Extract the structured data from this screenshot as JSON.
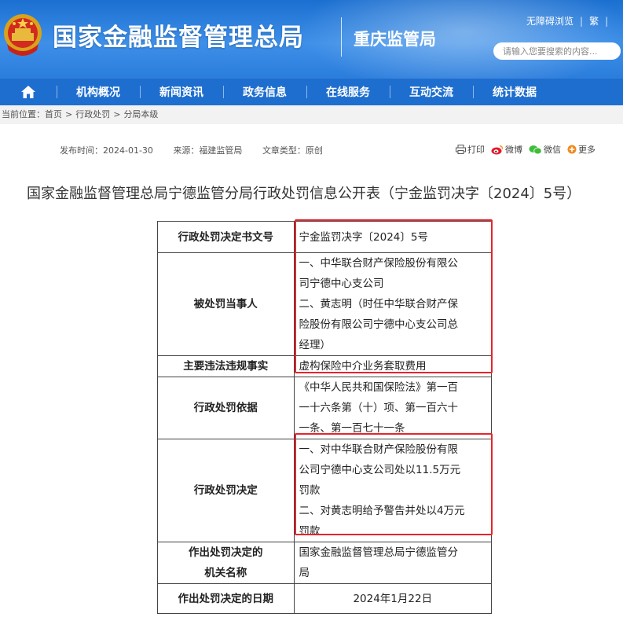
{
  "header": {
    "site_title": "国家金融监督管理总局",
    "bureau_name": "重庆监管局",
    "top_links": [
      "无障碍浏览",
      "繁"
    ],
    "search_placeholder": "请输入您要搜索的内容...",
    "colors": {
      "header_blue": "#2b7ddc",
      "nav_blue": "#1e6ecf",
      "highlight_red": "#e8232b"
    }
  },
  "nav": {
    "home_icon": "home-icon",
    "items": [
      "机构概况",
      "新闻资讯",
      "政务信息",
      "在线服务",
      "互动交流",
      "统计数据"
    ]
  },
  "breadcrumb": {
    "prefix": "当前位置：",
    "items": [
      "首页",
      "行政处罚",
      "分局本级"
    ],
    "separator": ">"
  },
  "meta": {
    "publish_date": "发布时间：2024-01-30",
    "source": "来源：福建监管局",
    "doc_type": "文章类型：原创"
  },
  "share": {
    "print": "打印",
    "weibo": "微博",
    "wechat": "微信",
    "more": "更多"
  },
  "document": {
    "title": "国家金融监督管理总局宁德监管分局行政处罚信息公开表（宁金监罚决字〔2024〕5号）",
    "rows": [
      {
        "label": "行政处罚决定书文号",
        "value": "宁金监罚决字〔2024〕5号"
      },
      {
        "label": "被处罚当事人",
        "value_lines": [
          "一、中华联合财产保险股份有限公",
          "司宁德中心支公司",
          "二、黄志明（时任中华联合财产保",
          "险股份有限公司宁德中心支公司总",
          "经理）"
        ]
      },
      {
        "label": "主要违法违规事实",
        "value": "虚构保险中介业务套取费用"
      },
      {
        "label": "行政处罚依据",
        "value_lines": [
          "《中华人民共和国保险法》第一百",
          "一十六条第（十）项、第一百六十",
          "一条、第一百七十一条"
        ]
      },
      {
        "label": "行政处罚决定",
        "value_lines": [
          "一、对中华联合财产保险股份有限",
          "公司宁德中心支公司处以11.5万元",
          "罚款",
          "二、对黄志明给予警告并处以4万元",
          "罚款"
        ]
      },
      {
        "label_lines": [
          "作出处罚决定的",
          "机关名称"
        ],
        "value_lines": [
          "国家金融监督管理总局宁德监管分",
          "局"
        ]
      },
      {
        "label": "作出处罚决定的日期",
        "value": "2024年1月22日"
      }
    ]
  }
}
